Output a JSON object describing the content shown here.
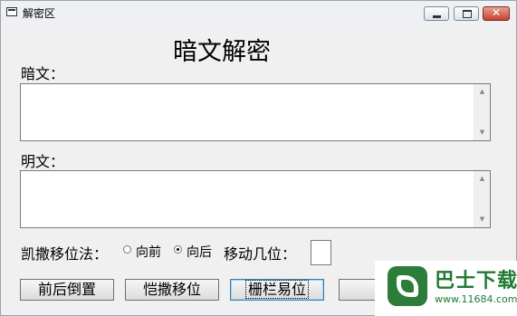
{
  "window": {
    "title": "解密区",
    "controls": {
      "minimize": "",
      "maximize": "",
      "close": "✕"
    }
  },
  "heading": "暗文解密",
  "cipher": {
    "label": "暗文：",
    "value": ""
  },
  "plain": {
    "label": "明文：",
    "value": ""
  },
  "caesar": {
    "label": "凯撒移位法：",
    "options": [
      {
        "label": "向前",
        "checked": false
      },
      {
        "label": "向后",
        "checked": true
      }
    ],
    "shift_label": "移动几位：",
    "shift_value": ""
  },
  "buttons": {
    "reverse": "前后倒置",
    "caesar_shift": "恺撒移位",
    "rail_fence": "栅栏易位",
    "back": "返"
  },
  "watermark": {
    "brand": "巴士下载",
    "url": "www.11684.com"
  }
}
